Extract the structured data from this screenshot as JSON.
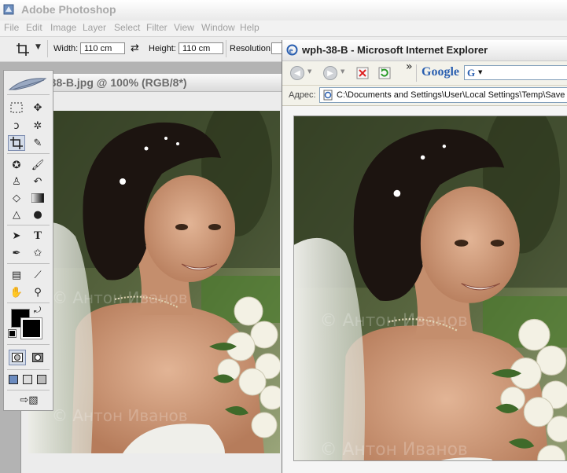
{
  "photoshop": {
    "app_title": "Adobe Photoshop",
    "menu": [
      "File",
      "Edit",
      "Image",
      "Layer",
      "Select",
      "Filter",
      "View",
      "Window",
      "Help"
    ],
    "options": {
      "width_label": "Width:",
      "width_value": "110 cm",
      "height_label": "Height:",
      "height_value": "110 cm",
      "resolution_label": "Resolution:"
    },
    "document_title": "-38-B.jpg @ 100% (RGB/8*)",
    "photo_watermark": "© Антон Иванов"
  },
  "ie": {
    "window_title": "wph-38-B - Microsoft Internet Explorer",
    "address_label": "Адрес:",
    "address_value": "C:\\Documents and Settings\\User\\Local Settings\\Temp\\Save F",
    "google_label": "Google",
    "google_box": "G",
    "chevron": "»"
  },
  "colors": {
    "ps_title_text": "#a9a9a9",
    "ie_accent": "#2a5fb0"
  }
}
